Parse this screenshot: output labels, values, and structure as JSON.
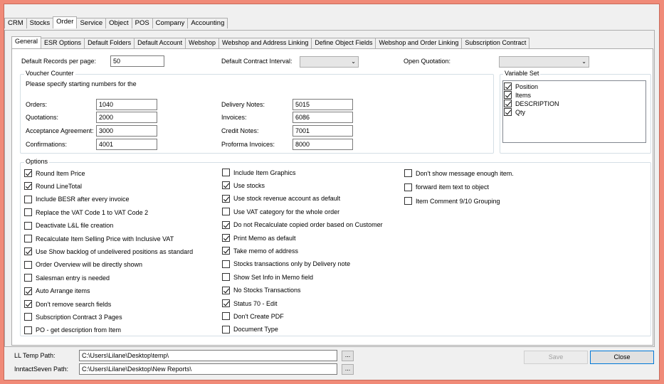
{
  "top_tabs": [
    "CRM",
    "Stocks",
    "Order",
    "Service",
    "Object",
    "POS",
    "Company",
    "Accounting"
  ],
  "sub_tabs": [
    "General",
    "ESR Options",
    "Default Folders",
    "Default Account",
    "Webshop",
    "Webshop and Address Linking",
    "Define Object Fields",
    "Webshop and Order Linking",
    "Subscription Contract"
  ],
  "general": {
    "default_records_label": "Default Records per page:",
    "default_records_value": "50",
    "default_contract_label": "Default Contract Interval:",
    "default_contract_value": "",
    "open_quotation_label": "Open Quotation:",
    "open_quotation_value": ""
  },
  "voucher": {
    "title": "Voucher Counter",
    "hint": "Please specify starting numbers for the",
    "orders_label": "Orders:",
    "orders_value": "1040",
    "quotations_label": "Quotations:",
    "quotations_value": "2000",
    "acceptance_label": "Acceptance Agreement:",
    "acceptance_value": "3000",
    "confirmations_label": "Confirmations:",
    "confirmations_value": "4001",
    "delivery_label": "Delivery Notes:",
    "delivery_value": "5015",
    "invoices_label": "Invoices:",
    "invoices_value": "6086",
    "credit_label": "Credit Notes:",
    "credit_value": "7001",
    "proforma_label": "Proforma Invoices:",
    "proforma_value": "8000"
  },
  "variable_set": {
    "title": "Variable Set",
    "items": [
      {
        "label": "Position",
        "checked": true
      },
      {
        "label": "Items",
        "checked": true
      },
      {
        "label": "DESCRIPTION",
        "checked": true
      },
      {
        "label": "Qty",
        "checked": true
      }
    ]
  },
  "options": {
    "title": "Options",
    "col1": [
      {
        "label": "Round Item Price",
        "checked": true
      },
      {
        "label": "Round LineTotal",
        "checked": true
      },
      {
        "label": "Include BESR after every invoice",
        "checked": false
      },
      {
        "label": "Replace the VAT Code 1 to VAT Code 2",
        "checked": false
      },
      {
        "label": "Deactivate L&L file creation",
        "checked": false
      },
      {
        "label": "Recalculate Item Selling Price with Inclusive VAT",
        "checked": false
      },
      {
        "label": "Use Show backlog of undelivered positions as standard",
        "checked": true
      },
      {
        "label": "Order Overview will be directly shown",
        "checked": false
      },
      {
        "label": "Salesman entry is needed",
        "checked": false
      },
      {
        "label": "Auto Arrange items",
        "checked": true
      },
      {
        "label": "Don't remove search fields",
        "checked": true
      },
      {
        "label": "Subscription Contract 3 Pages",
        "checked": false
      },
      {
        "label": "PO - get description from Item",
        "checked": false
      }
    ],
    "col2": [
      {
        "label": "Include Item Graphics",
        "checked": false
      },
      {
        "label": "Use stocks",
        "checked": true
      },
      {
        "label": "Use stock revenue account as default",
        "checked": true
      },
      {
        "label": "Use VAT category for the whole order",
        "checked": false
      },
      {
        "label": "Do not Recalculate copied order based on Customer",
        "checked": true
      },
      {
        "label": "Print Memo as default",
        "checked": true
      },
      {
        "label": "Take memo of address",
        "checked": true
      },
      {
        "label": "Stocks transactions only by Delivery note",
        "checked": false
      },
      {
        "label": "Show Set Info in Memo field",
        "checked": false
      },
      {
        "label": "No Stocks Transactions",
        "checked": true
      },
      {
        "label": "Status 70 - Edit",
        "checked": true
      },
      {
        "label": "Don't Create PDF",
        "checked": false
      },
      {
        "label": "Document Type",
        "checked": false
      }
    ],
    "col3": [
      {
        "label": "Don't show message enough item.",
        "checked": false
      },
      {
        "label": "forward item text to object",
        "checked": false
      },
      {
        "label": "Item Comment 9/10 Grouping",
        "checked": false
      }
    ]
  },
  "footer": {
    "ll_temp_label": "LL Temp Path:",
    "ll_temp_value": "C:\\Users\\Lilane\\Desktop\\temp\\",
    "inntact_label": "InntactSeven Path:",
    "inntact_value": "C:\\Users\\Lilane\\Desktop\\New Reports\\",
    "browse_label": "...",
    "save_label": "Save",
    "close_label": "Close"
  }
}
